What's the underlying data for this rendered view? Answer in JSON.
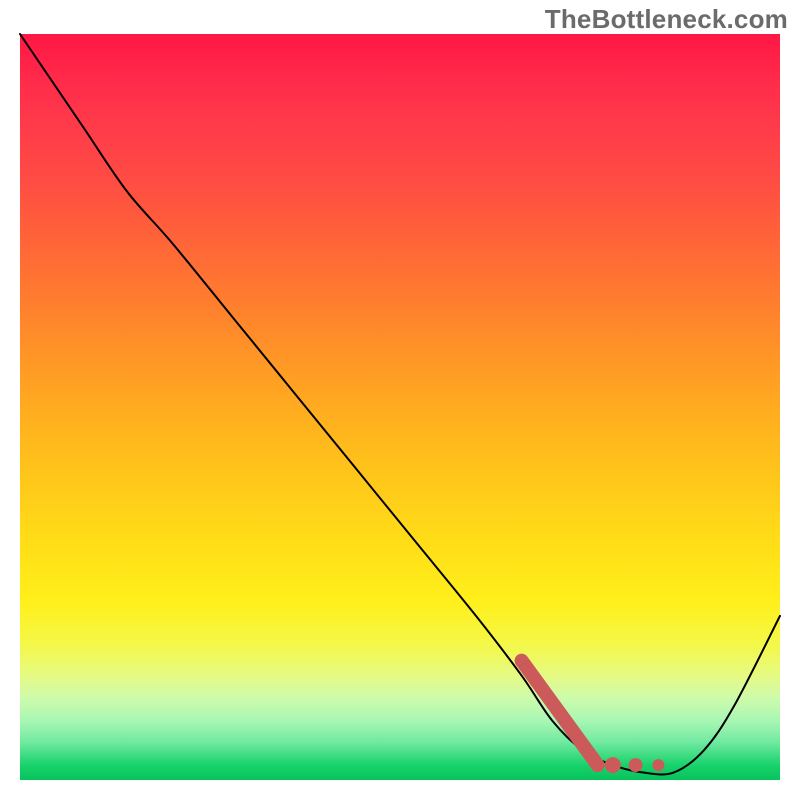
{
  "watermark": "TheBottleneck.com",
  "colors": {
    "curve": "#000000",
    "highlight": "#cc5a5a",
    "gradient_top": "#ff1744",
    "gradient_bottom": "#08c35e"
  },
  "chart_data": {
    "type": "line",
    "title": "",
    "xlabel": "",
    "ylabel": "",
    "xlim": [
      0,
      100
    ],
    "ylim": [
      0,
      100
    ],
    "series": [
      {
        "name": "bottleneck-curve",
        "x": [
          0,
          8,
          14,
          20,
          28,
          36,
          44,
          52,
          60,
          66,
          70,
          74,
          78,
          82,
          86,
          90,
          94,
          100
        ],
        "values": [
          100,
          88,
          79,
          72,
          62,
          52,
          42,
          32,
          22,
          14,
          8,
          4,
          2,
          1,
          1,
          4,
          10,
          22
        ]
      }
    ],
    "highlight": {
      "name": "optimal-range",
      "segment_x": [
        66,
        76
      ],
      "segment_y": [
        16,
        2
      ],
      "dots": [
        {
          "x": 78,
          "y": 2
        },
        {
          "x": 81,
          "y": 2
        },
        {
          "x": 84,
          "y": 2
        }
      ]
    },
    "annotations": []
  }
}
